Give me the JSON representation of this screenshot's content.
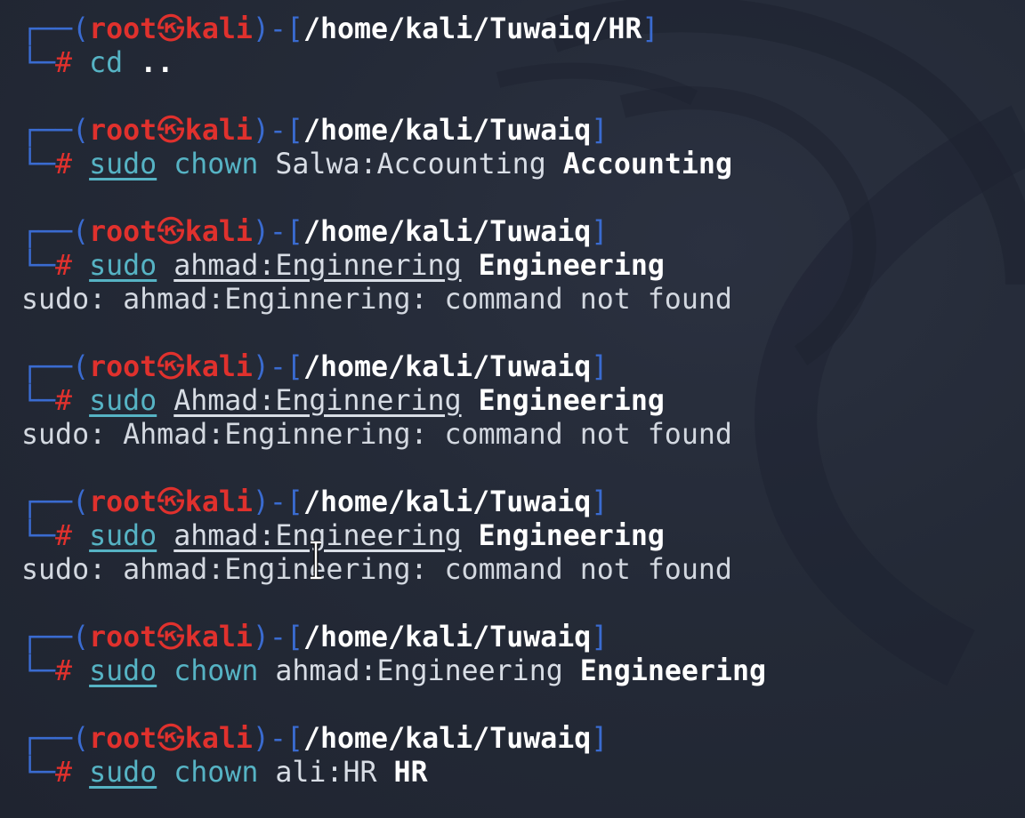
{
  "prompt": {
    "open": "┌──(",
    "user": "root",
    "skull": "㉿",
    "host": "kali",
    "mid": ")-[",
    "close": "]",
    "corner": "└─",
    "hash": "#"
  },
  "blocks": [
    {
      "path": "/home/kali/Tuwaiq/HR",
      "cmd": [
        {
          "t": "cd",
          "s": "cmd"
        },
        {
          "t": "..",
          "s": "argb"
        }
      ]
    },
    {
      "path": "/home/kali/Tuwaiq",
      "cmd": [
        {
          "t": "sudo",
          "s": "sudo"
        },
        {
          "t": "chown",
          "s": "cmd"
        },
        {
          "t": "Salwa:Accounting",
          "s": "arg"
        },
        {
          "t": "Accounting",
          "s": "argb"
        }
      ]
    },
    {
      "path": "/home/kali/Tuwaiq",
      "cmd": [
        {
          "t": "sudo",
          "s": "sudo"
        },
        {
          "t": "ahmad:Enginnering",
          "s": "arg-ul"
        },
        {
          "t": "Engineering",
          "s": "argb"
        }
      ],
      "output": "sudo: ahmad:Enginnering: command not found"
    },
    {
      "path": "/home/kali/Tuwaiq",
      "cmd": [
        {
          "t": "sudo",
          "s": "sudo"
        },
        {
          "t": "Ahmad:Enginnering",
          "s": "arg-ul"
        },
        {
          "t": "Engineering",
          "s": "argb"
        }
      ],
      "output": "sudo: Ahmad:Enginnering: command not found"
    },
    {
      "path": "/home/kali/Tuwaiq",
      "cmd": [
        {
          "t": "sudo",
          "s": "sudo"
        },
        {
          "t": "ahmad:Engineering",
          "s": "arg-ul"
        },
        {
          "t": "Engineering",
          "s": "argb"
        }
      ],
      "output": "sudo: ahmad:Engineering: command not found"
    },
    {
      "path": "/home/kali/Tuwaiq",
      "cmd": [
        {
          "t": "sudo",
          "s": "sudo"
        },
        {
          "t": "chown",
          "s": "cmd"
        },
        {
          "t": "ahmad:Engineering",
          "s": "arg"
        },
        {
          "t": "Engineering",
          "s": "argb"
        }
      ]
    },
    {
      "path": "/home/kali/Tuwaiq",
      "cmd": [
        {
          "t": "sudo",
          "s": "sudo"
        },
        {
          "t": "chown",
          "s": "cmd"
        },
        {
          "t": "ali:HR",
          "s": "arg"
        },
        {
          "t": "HR",
          "s": "argb"
        }
      ]
    }
  ],
  "colors": {
    "background": "#232836",
    "prompt_box": "#3a6bd0",
    "user_host": "#e0312d",
    "path": "#ffffff",
    "command": "#56b3c4",
    "text": "#d3d8e0"
  },
  "icons": {
    "cursor": "text-cursor-icon",
    "watermark": "kali-dragon-icon"
  }
}
